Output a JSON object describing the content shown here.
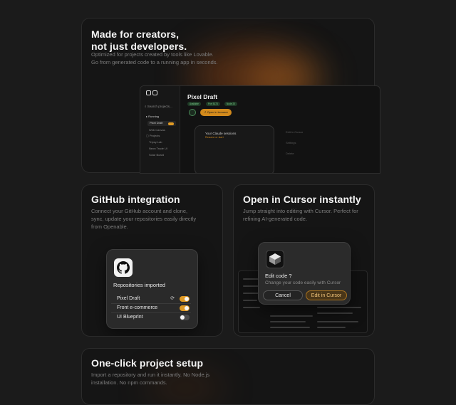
{
  "hero": {
    "title_line1": "Made for creators,",
    "title_line2": "not just developers.",
    "desc_line1": "Optimized for projects created by tools like Lovable.",
    "desc_line2": "Go from generated code to a running app in seconds.",
    "app": {
      "search_placeholder": "Search projects...",
      "section_running": "Running",
      "running_item": "Pixel Draft",
      "running_item2": "Web Canvas",
      "section_projects": "Projects",
      "project1": "Tripsy Lab",
      "project2": "Neon Trade UI",
      "project3": "Solar Board",
      "project_title": "Pixel Draft",
      "tags": [
        "Available",
        "Port 5173",
        "Node 20"
      ],
      "open_browser": "Open in browser",
      "sessions_title": "Your Claude sessions",
      "sessions_sub": "Resume or start",
      "ghost1": "Edit in Cursor",
      "ghost2": "Settings",
      "ghost3": "Delete"
    }
  },
  "github": {
    "title": "GitHub integration",
    "desc_line1": "Connect your GitHub account and clone,",
    "desc_line2": "sync, update your repositories easily directly",
    "desc_line3": "from Openable.",
    "card_title": "Repositories imported",
    "repos": [
      {
        "name": "Pixel Draft",
        "on": true,
        "sync": true
      },
      {
        "name": "Front e-commerce",
        "on": true,
        "sync": false
      },
      {
        "name": "UI Blueprint",
        "on": false,
        "sync": false
      }
    ]
  },
  "cursor": {
    "title": "Open in Cursor instantly",
    "desc_line1": "Jump straight into editing with Cursor. Perfect for",
    "desc_line2": "refining AI-generated code.",
    "dialog_title": "Edit code ?",
    "dialog_sub": "Change your code easily with Cursor",
    "cancel": "Cancel",
    "edit": "Edit in Cursor"
  },
  "setup": {
    "title": "One-click project setup",
    "desc_line1": "Import a repository and run it instantly. No Node.js",
    "desc_line2": "installation. No npm commands."
  },
  "colors": {
    "accent": "#e09a24",
    "card_bg": "#151515",
    "page_bg": "#1b1b1b"
  }
}
